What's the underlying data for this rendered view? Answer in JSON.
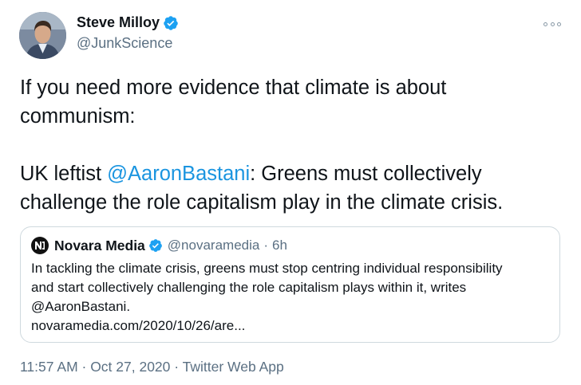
{
  "author": {
    "display_name": "Steve Milloy",
    "handle": "@JunkScience"
  },
  "tweet": {
    "line1": "If you need more evidence that climate is about communism:",
    "line2_prefix": "UK leftist ",
    "line2_mention": "@AaronBastani",
    "line2_suffix": ": Greens must collectively challenge the role capitalism play in the climate crisis."
  },
  "quoted_tweet": {
    "display_name": "Novara Media",
    "handle": "@novaramedia",
    "separator": "·",
    "time": "6h",
    "text_line1": "In tackling the climate crisis, greens must stop centring individual responsibility",
    "text_line2": "and start collectively challenging the role capitalism plays within it, writes",
    "text_line3": "@AaronBastani.",
    "text_line4": "novaramedia.com/2020/10/26/are..."
  },
  "meta": {
    "text": "11:57 AM · Oct 27, 2020 · Twitter Web App"
  },
  "colors": {
    "accent": "#1b95e0",
    "verified": "#1da1f2",
    "secondary_text": "#5b7083",
    "border": "#cfd9de"
  },
  "icons": [
    "verified-badge-icon",
    "more-options-icon",
    "novara-logo-icon"
  ]
}
